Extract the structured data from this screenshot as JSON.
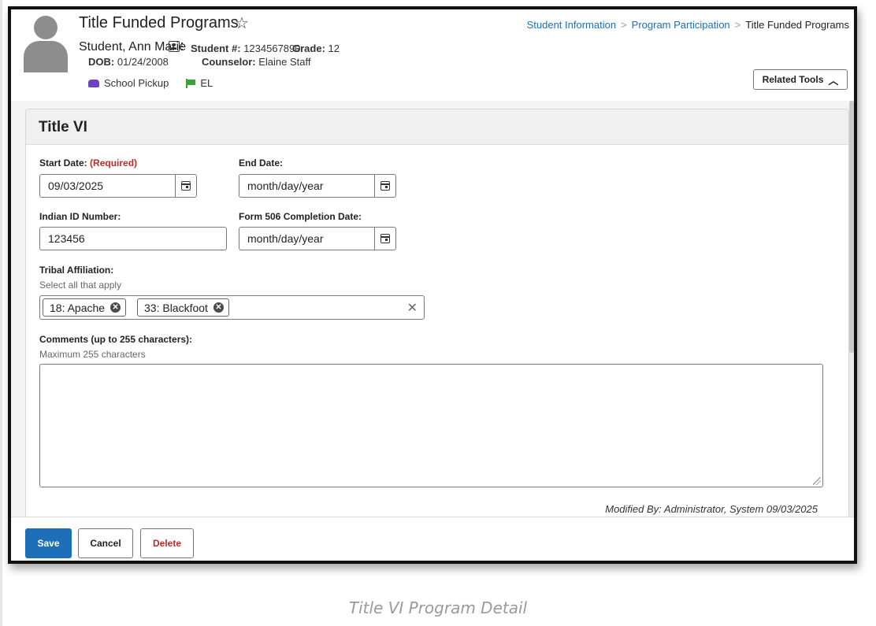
{
  "header": {
    "title": "Title Funded Programs",
    "star_icon": "star-outline-icon",
    "student_name": "Student, Ann Marie",
    "student_number_label": "Student #:",
    "student_number": "1234567890",
    "grade_label": "Grade:",
    "grade": "12",
    "dob_label": "DOB:",
    "dob": "01/24/2008",
    "counselor_label": "Counselor:",
    "counselor": "Elaine Staff",
    "badges": [
      {
        "icon": "car-icon",
        "label": "School Pickup",
        "color": "#6f42c1"
      },
      {
        "icon": "flag-icon",
        "label": "EL",
        "color": "#3aa335"
      }
    ]
  },
  "breadcrumb": {
    "items": [
      "Student Information",
      "Program Participation"
    ],
    "current": "Title Funded Programs",
    "separator": ">"
  },
  "related_tools": {
    "label": "Related Tools",
    "icon": "chevron-up-icon"
  },
  "panel": {
    "title": "Title VI",
    "start_date": {
      "label": "Start Date:",
      "required": "(Required)",
      "value": "09/03/2025"
    },
    "end_date": {
      "label": "End Date:",
      "value": "month/day/year"
    },
    "indian_id": {
      "label": "Indian ID Number:",
      "value": "123456"
    },
    "form506": {
      "label": "Form 506 Completion Date:",
      "value": "month/day/year"
    },
    "tribal": {
      "label": "Tribal Affiliation:",
      "hint": "Select all that apply",
      "selected": [
        "18: Apache",
        "33: Blackfoot"
      ],
      "clear_icon": "close-icon"
    },
    "comments": {
      "label": "Comments (up to 255 characters):",
      "hint": "Maximum 255 characters",
      "value": ""
    },
    "modified_by": "Modified By: Administrator, System 09/03/2025"
  },
  "footer": {
    "save": "Save",
    "cancel": "Cancel",
    "delete": "Delete"
  },
  "caption": "Title VI Program Detail",
  "colors": {
    "link": "#1b6fbf",
    "primary": "#1d6fb8",
    "danger": "#c62828"
  }
}
